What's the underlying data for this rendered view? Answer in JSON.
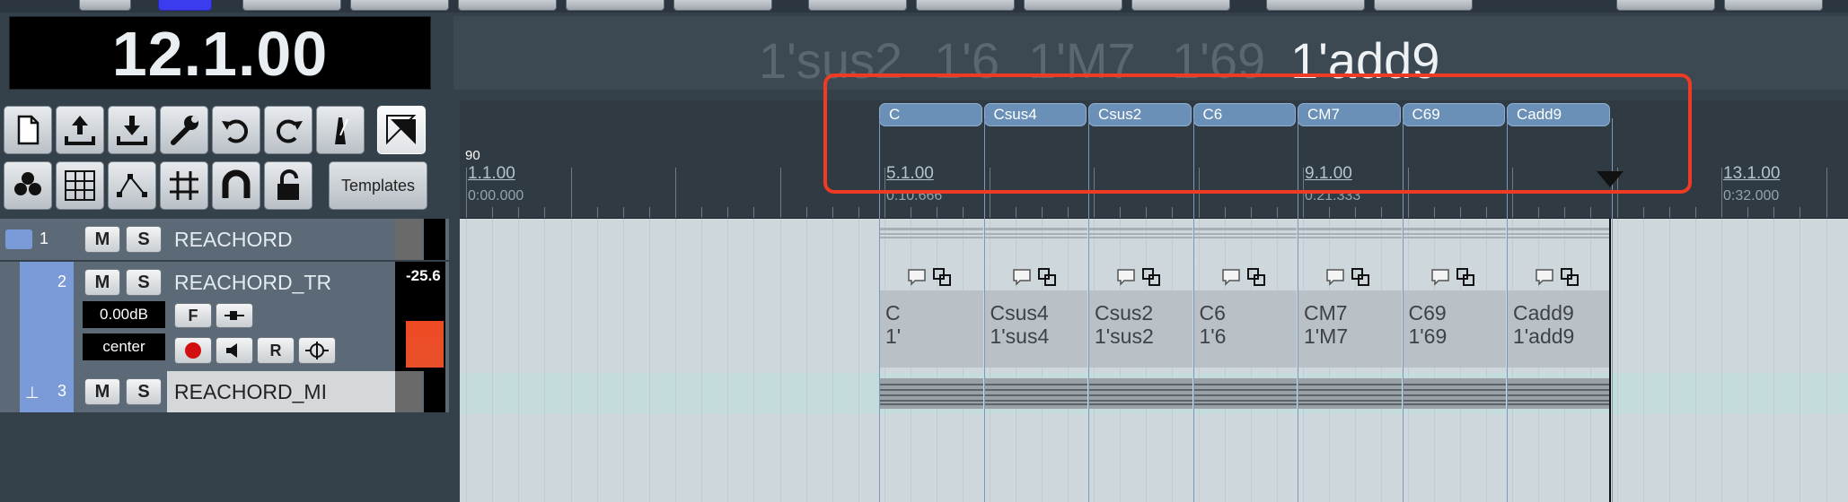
{
  "position_display": "12.1.00",
  "chord_display": {
    "previous": [
      "1'sus2",
      "1'6",
      "1'M7",
      "1'69"
    ],
    "current": "1'add9"
  },
  "toolbar": {
    "row1": [
      "new-project-icon",
      "open-project-icon",
      "save-project-icon",
      "settings-wrench-icon",
      "undo-icon",
      "redo-icon",
      "metronome-icon",
      "select-tool-icon"
    ],
    "row2": [
      "club-icon",
      "grid-icon",
      "node-icon",
      "snap-grid-icon",
      "magnet-icon",
      "lock-icon"
    ],
    "templates_label": "Templates"
  },
  "tracks": [
    {
      "num": "1",
      "name": "REACHORD",
      "mute": "M",
      "solo": "S"
    },
    {
      "num": "2",
      "name": "REACHORD_TR",
      "mute": "M",
      "solo": "S",
      "volume": "0.00dB",
      "pan": "center",
      "meter_value": "-25.6",
      "f_label": "F",
      "r_label": "R"
    },
    {
      "num": "3",
      "name": "REACHORD_MI",
      "mute": "M",
      "solo": "S"
    }
  ],
  "tempo": "90",
  "ruler": [
    {
      "bar": "1.1.00",
      "time": "0:00.000"
    },
    {
      "bar": "5.1.00",
      "time": "0:10.666"
    },
    {
      "bar": "9.1.00",
      "time": "0:21.333"
    },
    {
      "bar": "13.1.00",
      "time": "0:32.000"
    }
  ],
  "chords": [
    {
      "label": "C",
      "line1": "C",
      "line2": "1'"
    },
    {
      "label": "Csus4",
      "line1": "Csus4",
      "line2": "1'sus4"
    },
    {
      "label": "Csus2",
      "line1": "Csus2",
      "line2": "1'sus2"
    },
    {
      "label": "C6",
      "line1": "C6",
      "line2": "1'6"
    },
    {
      "label": "CM7",
      "line1": "CM7",
      "line2": "1'M7"
    },
    {
      "label": "C69",
      "line1": "C69",
      "line2": "1'69"
    },
    {
      "label": "Cadd9",
      "line1": "Cadd9",
      "line2": "1'add9"
    }
  ],
  "colors": {
    "chord_pill": "#6a90b8",
    "highlight": "#ef3a24",
    "track_selected": "#7a9ad8",
    "meter": "#ef4a24"
  }
}
